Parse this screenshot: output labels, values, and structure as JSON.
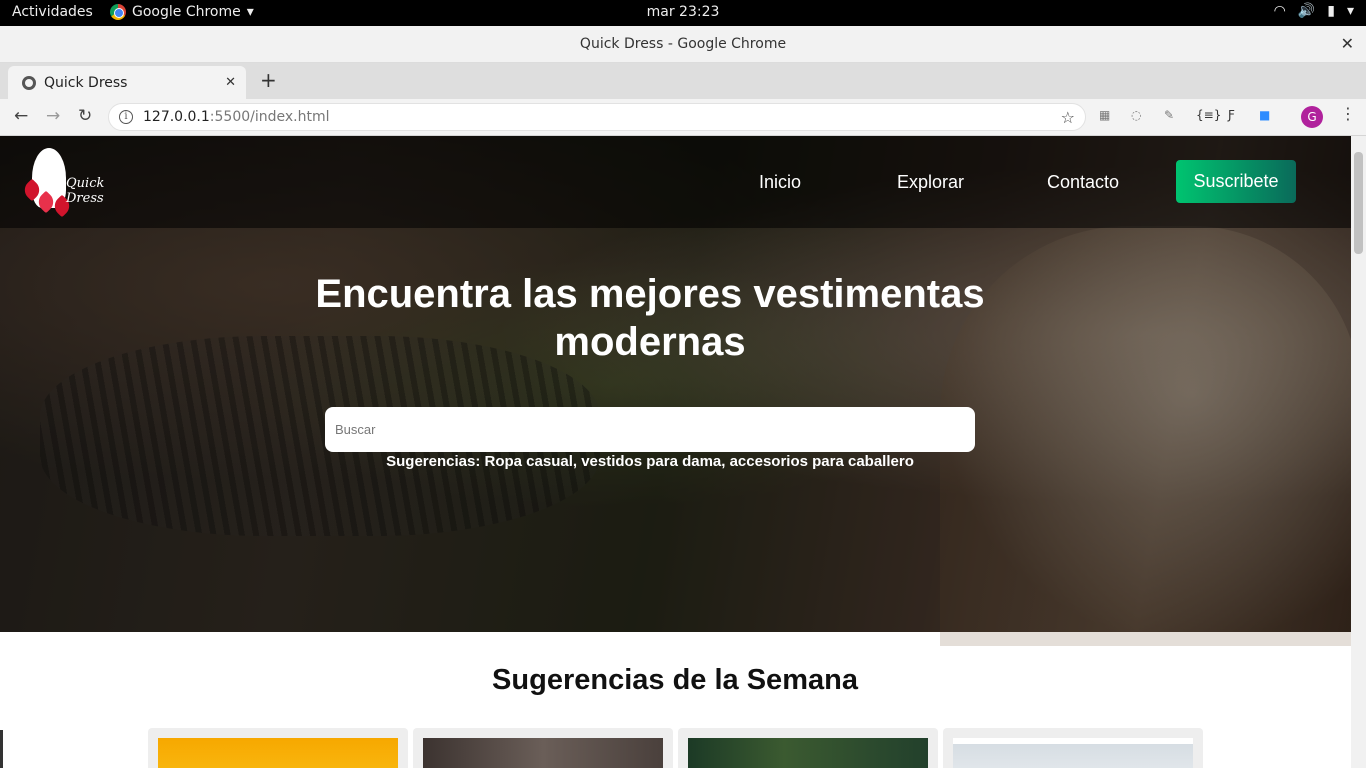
{
  "system": {
    "activities": "Actividades",
    "app_name": "Google Chrome",
    "clock": "mar 23:23"
  },
  "window": {
    "title": "Quick Dress - Google Chrome"
  },
  "tab": {
    "label": "Quick Dress"
  },
  "address_bar": {
    "host": "127.0.0.1",
    "path": ":5500/index.html"
  },
  "profile": {
    "initial": "G"
  },
  "site": {
    "brand": "Quick Dress",
    "nav": {
      "inicio": "Inicio",
      "explorar": "Explorar",
      "contacto": "Contacto",
      "subscribe": "Suscribete"
    },
    "hero": {
      "title_line1": "Encuentra las mejores vestimentas",
      "title_line2": "modernas",
      "search_placeholder": "Buscar",
      "suggestions": "Sugerencias: Ropa casual, vestidos para dama, accesorios para caballero"
    },
    "section_title": "Sugerencias de la Semana"
  },
  "colors": {
    "subscribe_gradient_start": "#00c470",
    "subscribe_gradient_end": "#0a6a5a",
    "profile_avatar": "#b0219c",
    "logo_accent": "#d1142c"
  }
}
